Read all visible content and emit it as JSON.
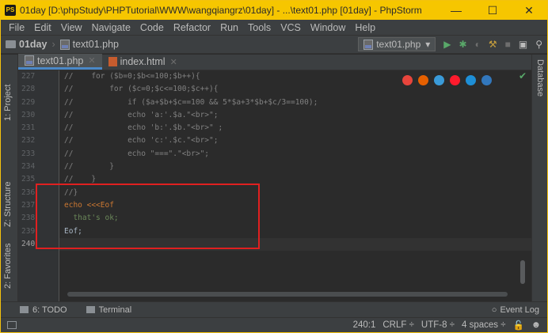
{
  "window": {
    "title": "01day [D:\\phpStudy\\PHPTutorial\\WWW\\wangqiangrz\\01day] - ...\\text01.php [01day] - PhpStorm",
    "app_icon_text": "PS",
    "minimize": "—",
    "maximize": "☐",
    "close": "✕"
  },
  "menu": [
    "File",
    "Edit",
    "View",
    "Navigate",
    "Code",
    "Refactor",
    "Run",
    "Tools",
    "VCS",
    "Window",
    "Help"
  ],
  "navbar": {
    "project": "01day",
    "file": "text01.php",
    "run_config": "text01.php"
  },
  "tool_windows": {
    "project": "1: Project",
    "structure": "Z: Structure",
    "favorites": "2: Favorites",
    "database": "Database"
  },
  "tabs": [
    {
      "label": "text01.php",
      "active": true
    },
    {
      "label": "index.html",
      "active": false
    }
  ],
  "code": {
    "line_numbers": [
      "227",
      "228",
      "229",
      "230",
      "231",
      "232",
      "233",
      "234",
      "235",
      "236",
      "237",
      "238",
      "239",
      "240"
    ],
    "lines": [
      "//    for ($b=0;$b<=100;$b++){",
      "//        for ($c=0;$c<=100;$c++){",
      "//            if ($a+$b+$c==100 && 5*$a+3*$b+$c/3==100);",
      "//            echo 'a:'.$a.\"<br>\";",
      "//            echo 'b:'.$b.\"<br>\" ;",
      "//            echo 'c:'.$c.\"<br>\";",
      "//            echo \"===\".\"<br>\";",
      "//        }",
      "//    }",
      "//}",
      "echo <<<Eof",
      "  that's ok;",
      "Eof;",
      ""
    ]
  },
  "bottom_tools": {
    "todo": "6: TODO",
    "terminal": "Terminal",
    "event_log": "Event Log"
  },
  "status": {
    "position": "240:1",
    "line_sep": "CRLF ÷",
    "encoding": "UTF-8 ÷",
    "indent": "4 spaces ÷"
  },
  "colors": {
    "title_bar": "#f6c600",
    "highlight_box": "#e02020",
    "accent": "#4a88c7"
  }
}
